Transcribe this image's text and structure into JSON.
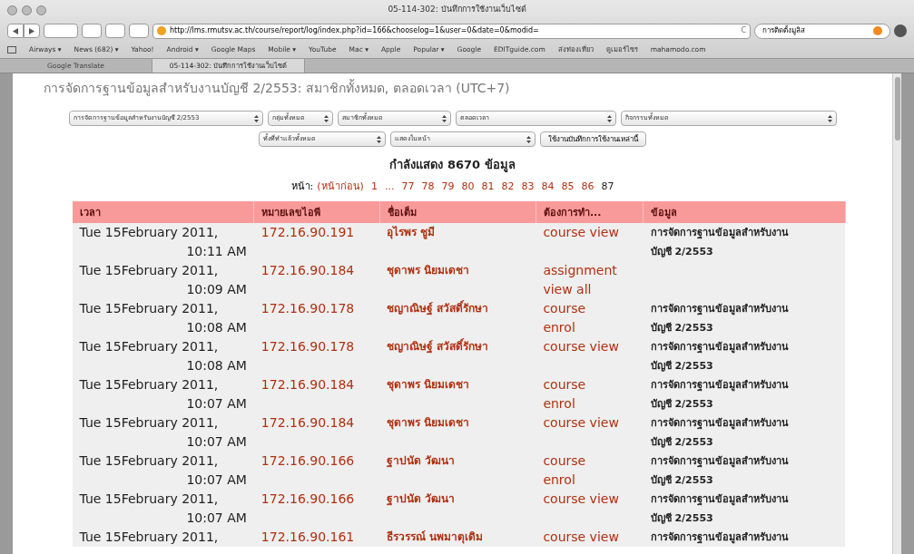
{
  "window": {
    "title": "05-114-302: บันทึกการใช้งานเว็บไซต์"
  },
  "toolbar": {
    "url": "http://lms.rmutsv.ac.th/course/report/log/index.php?id=166&chooselog=1&user=0&date=0&modid=",
    "reload": "C",
    "search": "การติดตั้งมูลิส"
  },
  "bookmarks": [
    "Airways ▾",
    "News (682) ▾",
    "Yahoo!",
    "Android ▾",
    "Google Maps",
    "Mobile ▾",
    "YouTube",
    "Mac ▾",
    "Apple",
    "Popular ▾",
    "Google",
    "EDITguide.com",
    "ส่งท่องเที่ยว",
    "ดูเมอร์ไซร",
    "mahamodo.com"
  ],
  "tabs": [
    {
      "label": "Google Translate",
      "selected": false
    },
    {
      "label": "05-114-302: บันทึกการใช้งานเว็บไซต์",
      "selected": true
    }
  ],
  "heading": "การจัดการฐานข้อมูลสำหรับงานบัญชี 2/2553: สมาชิกทั้งหมด, ตลอดเวลา (UTC+7)",
  "filters": [
    [
      "การจัดการฐานข้อมูลสำหรับงานบัญชี 2/2553",
      "กลุ่มทั้งหมด",
      "สมาชิกทั้งหมด",
      "ตลอดเวลา",
      "กิจกรรมทั้งหมด"
    ],
    [
      "ทั้งที่ทำแล้วทั้งหมด",
      "แสดงในหน้า"
    ]
  ],
  "filter_button": "ใช้งานบันทึกการใช้งานเหล่านี้",
  "summary": "กำลังแสดง 8670 ข้อมูล",
  "pager": {
    "label": "หน้า:",
    "prev": "(หน้าก่อน)",
    "pages": [
      {
        "label": "1",
        "selected": false
      },
      {
        "label": "...",
        "selected": false
      },
      {
        "label": "77",
        "selected": false
      },
      {
        "label": "78",
        "selected": false
      },
      {
        "label": "79",
        "selected": false
      },
      {
        "label": "80",
        "selected": false
      },
      {
        "label": "81",
        "selected": false
      },
      {
        "label": "82",
        "selected": false
      },
      {
        "label": "83",
        "selected": false
      },
      {
        "label": "84",
        "selected": false
      },
      {
        "label": "85",
        "selected": false
      },
      {
        "label": "86",
        "selected": false
      },
      {
        "label": "87",
        "selected": true
      }
    ]
  },
  "table": {
    "columns": [
      "เวลา",
      "หมายเลขไอพี",
      "ชื่อเต็ม",
      "ต้องการทำ...",
      "ข้อมูล"
    ],
    "rows": [
      {
        "date": "Tue 15February 2011,",
        "time": "10:11 AM",
        "ip": "172.16.90.191",
        "name": "อุไรพร ชูมี",
        "action": [
          "course view"
        ],
        "info": [
          "การจัดการฐานข้อมูลสำหรับงาน",
          "บัญชี 2/2553"
        ]
      },
      {
        "date": "Tue 15February 2011,",
        "time": "10:09 AM",
        "ip": "172.16.90.184",
        "name": "ชุดาพร นิยมเดชา",
        "action": [
          "assignment",
          "view all"
        ],
        "info": []
      },
      {
        "date": "Tue 15February 2011,",
        "time": "10:08 AM",
        "ip": "172.16.90.178",
        "name": "ชญาณิษฐ์ สวัสดิ์รักษา",
        "action": [
          "course",
          "enrol"
        ],
        "info": [
          "การจัดการฐานข้อมูลสำหรับงาน",
          "บัญชี 2/2553"
        ]
      },
      {
        "date": "Tue 15February 2011,",
        "time": "10:08 AM",
        "ip": "172.16.90.178",
        "name": "ชญาณิษฐ์ สวัสดิ์รักษา",
        "action": [
          "course view"
        ],
        "info": [
          "การจัดการฐานข้อมูลสำหรับงาน",
          "บัญชี 2/2553"
        ]
      },
      {
        "date": "Tue 15February 2011,",
        "time": "10:07 AM",
        "ip": "172.16.90.184",
        "name": "ชุดาพร นิยมเดชา",
        "action": [
          "course",
          "enrol"
        ],
        "info": [
          "การจัดการฐานข้อมูลสำหรับงาน",
          "บัญชี 2/2553"
        ]
      },
      {
        "date": "Tue 15February 2011,",
        "time": "10:07 AM",
        "ip": "172.16.90.184",
        "name": "ชุดาพร นิยมเดชา",
        "action": [
          "course view"
        ],
        "info": [
          "การจัดการฐานข้อมูลสำหรับงาน",
          "บัญชี 2/2553"
        ]
      },
      {
        "date": "Tue 15February 2011,",
        "time": "10:07 AM",
        "ip": "172.16.90.166",
        "name": "ฐาปนัด วัฒนา",
        "action": [
          "course",
          "enrol"
        ],
        "info": [
          "การจัดการฐานข้อมูลสำหรับงาน",
          "บัญชี 2/2553"
        ]
      },
      {
        "date": "Tue 15February 2011,",
        "time": "10:07 AM",
        "ip": "172.16.90.166",
        "name": "ฐาปนัด วัฒนา",
        "action": [
          "course view"
        ],
        "info": [
          "การจัดการฐานข้อมูลสำหรับงาน",
          "บัญชี 2/2553"
        ]
      },
      {
        "date": "Tue 15February 2011,",
        "ip": "172.16.90.161",
        "name": "ธีรวรรณ์ นพมาตุเดิม",
        "action": [
          "course view"
        ],
        "info": [
          "การจัดการฐานข้อมูลสำหรับงาน"
        ]
      }
    ]
  }
}
